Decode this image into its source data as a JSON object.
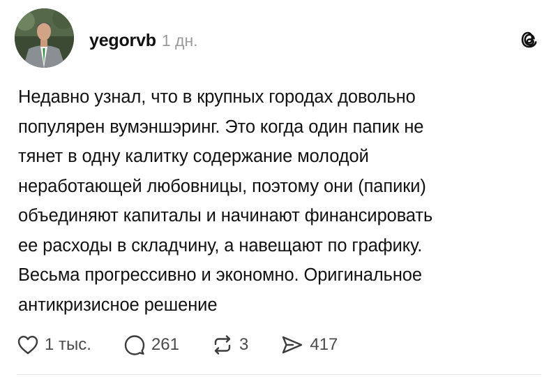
{
  "post": {
    "author": {
      "username": "yegorvb",
      "avatar": "profile-photo"
    },
    "timestamp": "1 дн.",
    "app_icon": "threads-logo-icon",
    "text": "Недавно узнал, что в крупных городах довольно\nпопулярен вумэншэринг. Это когда один папик не\nтянет в одну калитку содержание молодой\nнеработающей любовницы, поэтому они (папики)\nобъединяют капиталы и начинают финансировать\nее расходы в складчину, а навещают по графику.\nВесьма прогрессивно и экономно. Оригинальное\nантикризисное решение",
    "actions": {
      "like": {
        "icon": "heart-icon",
        "count": "1 тыс."
      },
      "comment": {
        "icon": "comment-bubble-icon",
        "count": "261"
      },
      "repost": {
        "icon": "repost-icon",
        "count": "3"
      },
      "share": {
        "icon": "send-icon",
        "count": "417"
      }
    }
  }
}
